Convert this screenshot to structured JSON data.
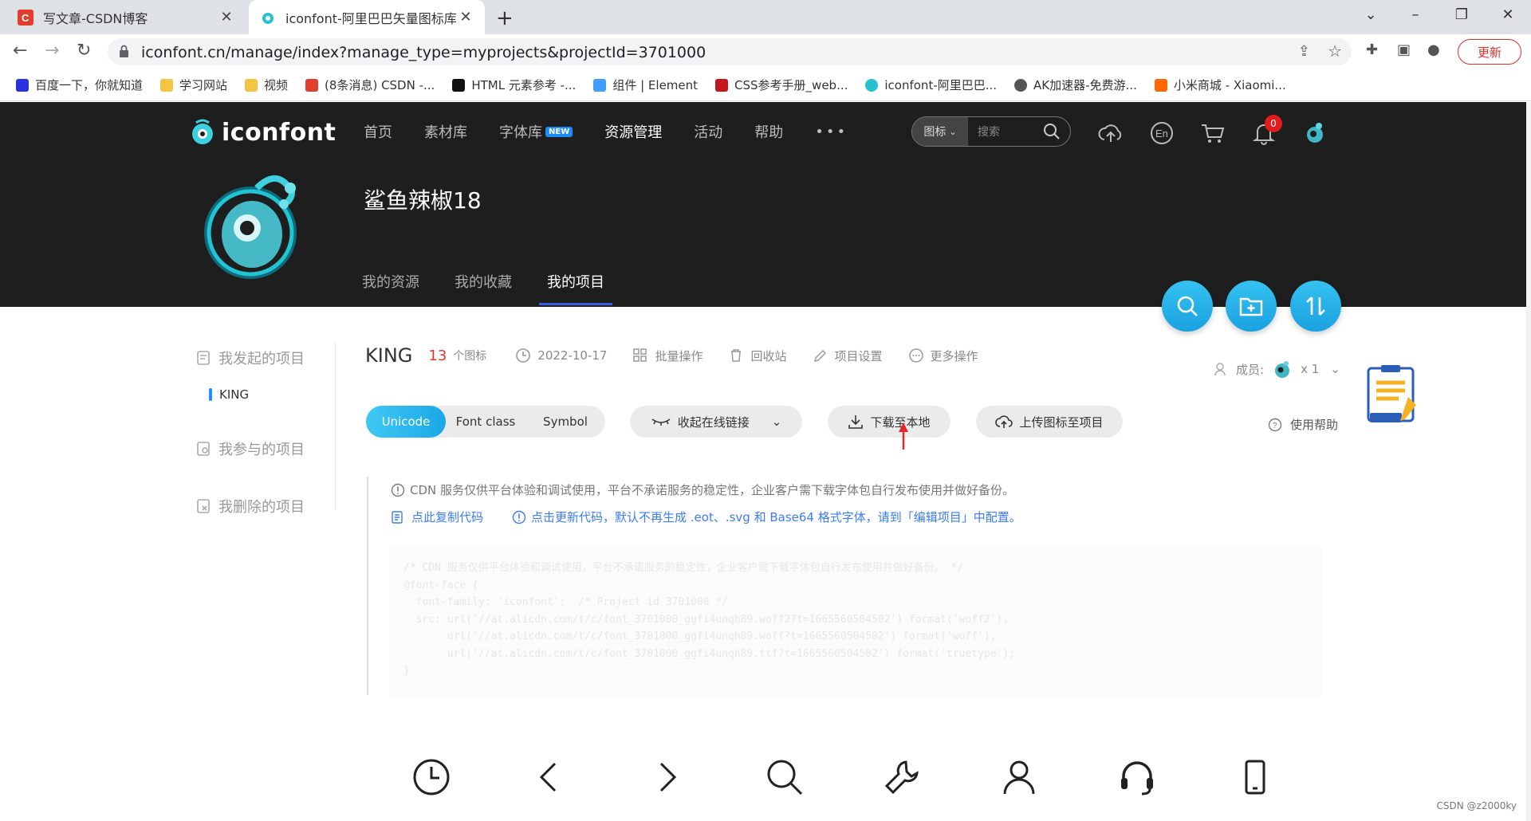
{
  "browser": {
    "tabs": [
      {
        "title": "写文章-CSDN博客",
        "active": false
      },
      {
        "title": "iconfont-阿里巴巴矢量图标库",
        "active": true
      }
    ],
    "url": "iconfont.cn/manage/index?manage_type=myprojects&projectId=3701000",
    "update_label": "更新",
    "bookmarks": [
      {
        "label": "百度一下，你就知道",
        "icon": "baidu-icon"
      },
      {
        "label": "学习网站",
        "icon": "folder-icon"
      },
      {
        "label": "视频",
        "icon": "folder-icon"
      },
      {
        "label": "(8条消息) CSDN -...",
        "icon": "csdn-icon"
      },
      {
        "label": "HTML 元素参考 -...",
        "icon": "mdn-icon"
      },
      {
        "label": "组件 | Element",
        "icon": "element-icon"
      },
      {
        "label": "CSS参考手册_web...",
        "icon": "css-icon"
      },
      {
        "label": "iconfont-阿里巴巴...",
        "icon": "iconfont-icon"
      },
      {
        "label": "AK加速器-免费游...",
        "icon": "ak-icon"
      },
      {
        "label": "小米商城 - Xiaomi...",
        "icon": "mi-icon"
      }
    ]
  },
  "site": {
    "logo_text": "iconfont",
    "nav": [
      "首页",
      "素材库",
      "字体库",
      "资源管理",
      "活动",
      "帮助"
    ],
    "nav_new_badge": "NEW",
    "nav_more": "•••",
    "search_type": "图标",
    "search_placeholder": "搜索",
    "notify_count": "0",
    "username": "鲨鱼辣椒18",
    "subnav": [
      "我的资源",
      "我的收藏",
      "我的项目"
    ]
  },
  "sidebar": {
    "started": "我发起的项目",
    "current_project": "KING",
    "joined": "我参与的项目",
    "deleted": "我删除的项目"
  },
  "project": {
    "name": "KING",
    "count": "13",
    "count_unit": "个图标",
    "date": "2022-10-17",
    "ops": [
      "批量操作",
      "回收站",
      "项目设置",
      "更多操作"
    ],
    "members_label": "成员:",
    "members_count": "x 1",
    "help": "使用帮助",
    "modes": [
      "Unicode",
      "Font class",
      "Symbol"
    ],
    "collapse_link": "收起在线链接",
    "download": "下载至本地",
    "upload": "上传图标至项目",
    "notice": "CDN 服务仅供平台体验和调试使用，平台不承诺服务的稳定性，企业客户需下载字体包自行发布使用并做好备份。",
    "copy_code": "点此复制代码",
    "update_code": "点击更新代码，默认不再生成 .eot、.svg 和 Base64 格式字体，请到「编辑项目」中配置。",
    "code": "/* CDN 服务仅供平台体验和调试使用，平台不承诺服务的稳定性，企业客户需下载字体包自行发布使用并做好备份。 */\n@font-face {\n  font-family: 'iconfont';  /* Project id 3701000 */\n  src: url('//at.alicdn.com/t/c/font_3701000_ggfi4unqh89.woff2?t=1665560504502') format('woff2'),\n       url('//at.alicdn.com/t/c/font_3701000_ggfi4unqh89.woff?t=1665560504502') format('woff'),\n       url('//at.alicdn.com/t/c/font_3701000_ggfi4unqh89.ttf?t=1665560504502') format('truetype');\n}"
  },
  "watermark": "CSDN @z2000ky",
  "colors": {
    "accent": "#1aa7e6",
    "header_bg": "#1e1e1e",
    "count_red": "#e5352b",
    "link_blue": "#3b7cf6"
  }
}
